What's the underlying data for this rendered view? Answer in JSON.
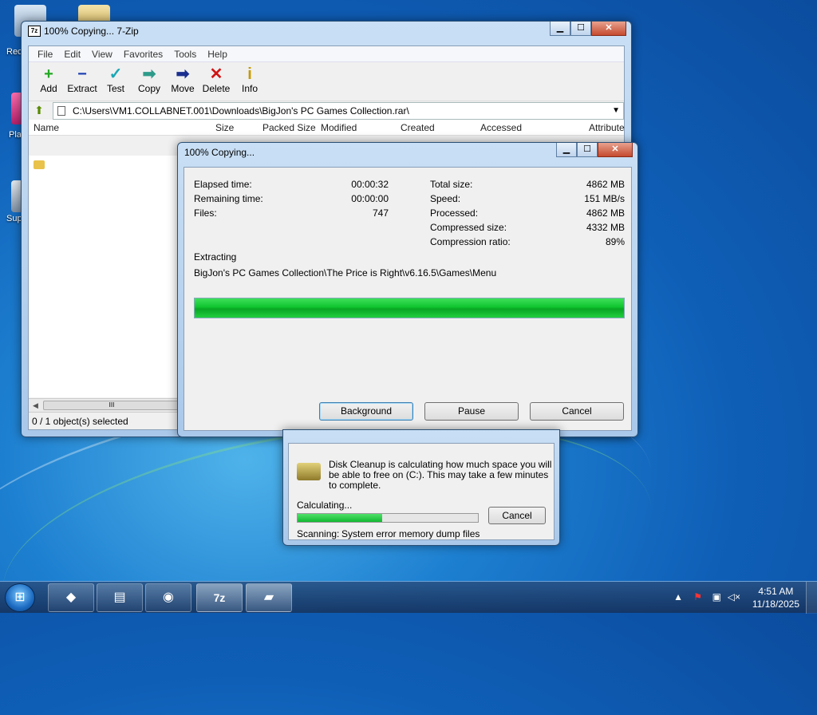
{
  "desktop": {
    "labels": [
      "Rec",
      "Pla",
      "Sup"
    ]
  },
  "zip_window": {
    "title": "100% Copying... 7-Zip",
    "app_icon_text": "7z",
    "menu": [
      "File",
      "Edit",
      "View",
      "Favorites",
      "Tools",
      "Help"
    ],
    "toolbar": [
      {
        "label": "Add",
        "icon": "plus-icon",
        "glyph": "+",
        "color": "#22a822"
      },
      {
        "label": "Extract",
        "icon": "minus-icon",
        "glyph": "−",
        "color": "#1a3fb0"
      },
      {
        "label": "Test",
        "icon": "check-arrow-icon",
        "glyph": "✓",
        "color": "#1aa7b5"
      },
      {
        "label": "Copy",
        "icon": "copy-arrow-icon",
        "glyph": "➡",
        "color": "#2e9b8a"
      },
      {
        "label": "Move",
        "icon": "move-arrow-icon",
        "glyph": "➡",
        "color": "#1a2f8f"
      },
      {
        "label": "Delete",
        "icon": "delete-x-icon",
        "glyph": "✕",
        "color": "#d01515"
      },
      {
        "label": "Info",
        "icon": "info-icon",
        "glyph": "i",
        "color": "#c59a00"
      }
    ],
    "path": "C:\\Users\\VM1.COLLABNET.001\\Downloads\\BigJon's PC Games Collection.rar\\",
    "columns": [
      "Name",
      "Size",
      "Packed Size",
      "Modified",
      "Created",
      "Accessed",
      "Attribute"
    ],
    "status": "0 / 1 object(s) selected"
  },
  "progress_dialog": {
    "title": "100% Copying...",
    "left_labels": [
      "Elapsed time:",
      "Remaining time:",
      "Files:"
    ],
    "left_values": [
      "00:00:32",
      "00:00:00",
      "747"
    ],
    "right_labels": [
      "Total size:",
      "Speed:",
      "Processed:",
      "Compressed size:",
      "Compression ratio:"
    ],
    "right_values": [
      "4862 MB",
      "151 MB/s",
      "4862 MB",
      "4332 MB",
      "89%"
    ],
    "operation": "Extracting",
    "current_path": "BigJon's PC Games Collection\\The Price is Right\\v6.16.5\\Games\\Menu",
    "progress": 1.0,
    "buttons": [
      "Background",
      "Pause",
      "Cancel"
    ]
  },
  "disk_cleanup": {
    "message": "Disk Cleanup is calculating how much space you will be able to free on  (C:). This may take a few minutes to complete.",
    "calculating_label": "Calculating...",
    "progress": 0.47,
    "cancel_label": "Cancel",
    "scanning_label": "Scanning:",
    "scanning_item": "System error memory dump files"
  },
  "taskbar": {
    "time": "4:51 AM",
    "date": "11/18/2025",
    "pinned": [
      "media-center-icon",
      "explorer-folder-icon",
      "browser-icon",
      "7zip-icon",
      "disk-cleanup-icon"
    ],
    "pinned_glyphs": [
      "◆",
      "▤",
      "◉",
      "7z",
      "▰"
    ]
  }
}
